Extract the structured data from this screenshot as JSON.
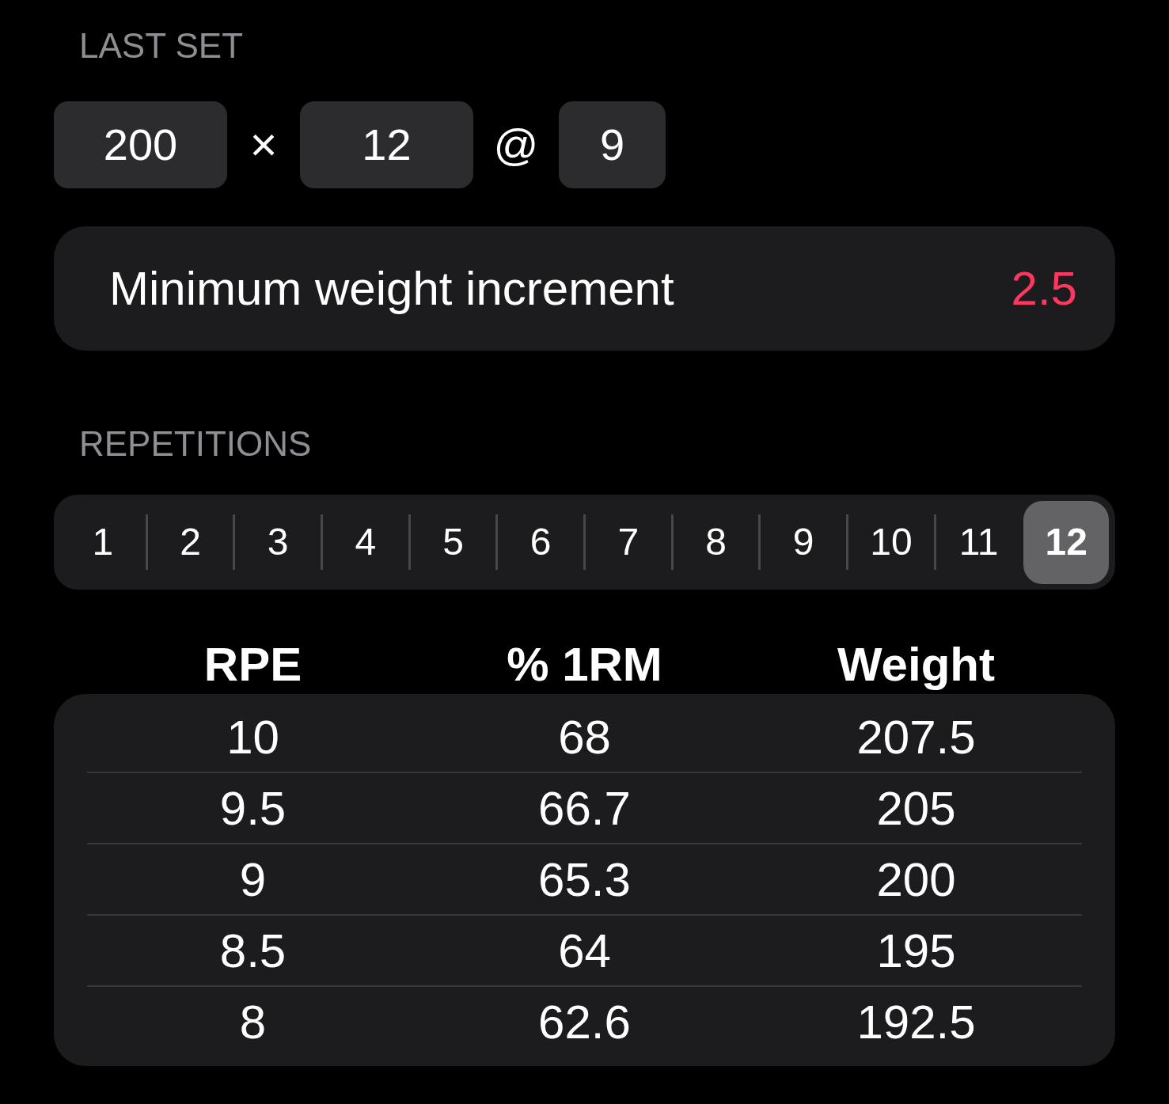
{
  "last_set": {
    "label": "LAST SET",
    "weight": "200",
    "times_sign": "×",
    "reps": "12",
    "at_sign": "@",
    "rpe": "9"
  },
  "increment": {
    "label": "Minimum weight increment",
    "value": "2.5"
  },
  "repetitions": {
    "label": "REPETITIONS",
    "options": [
      {
        "label": "1",
        "selected": false
      },
      {
        "label": "2",
        "selected": false
      },
      {
        "label": "3",
        "selected": false
      },
      {
        "label": "4",
        "selected": false
      },
      {
        "label": "5",
        "selected": false
      },
      {
        "label": "6",
        "selected": false
      },
      {
        "label": "7",
        "selected": false
      },
      {
        "label": "8",
        "selected": false
      },
      {
        "label": "9",
        "selected": false
      },
      {
        "label": "10",
        "selected": false
      },
      {
        "label": "11",
        "selected": false
      },
      {
        "label": "12",
        "selected": true
      }
    ]
  },
  "table": {
    "columns": [
      "RPE",
      "% 1RM",
      "Weight"
    ],
    "rows": [
      [
        "10",
        "68",
        "207.5"
      ],
      [
        "9.5",
        "66.7",
        "205"
      ],
      [
        "9",
        "65.3",
        "200"
      ],
      [
        "8.5",
        "64",
        "195"
      ],
      [
        "8",
        "62.6",
        "192.5"
      ]
    ]
  }
}
